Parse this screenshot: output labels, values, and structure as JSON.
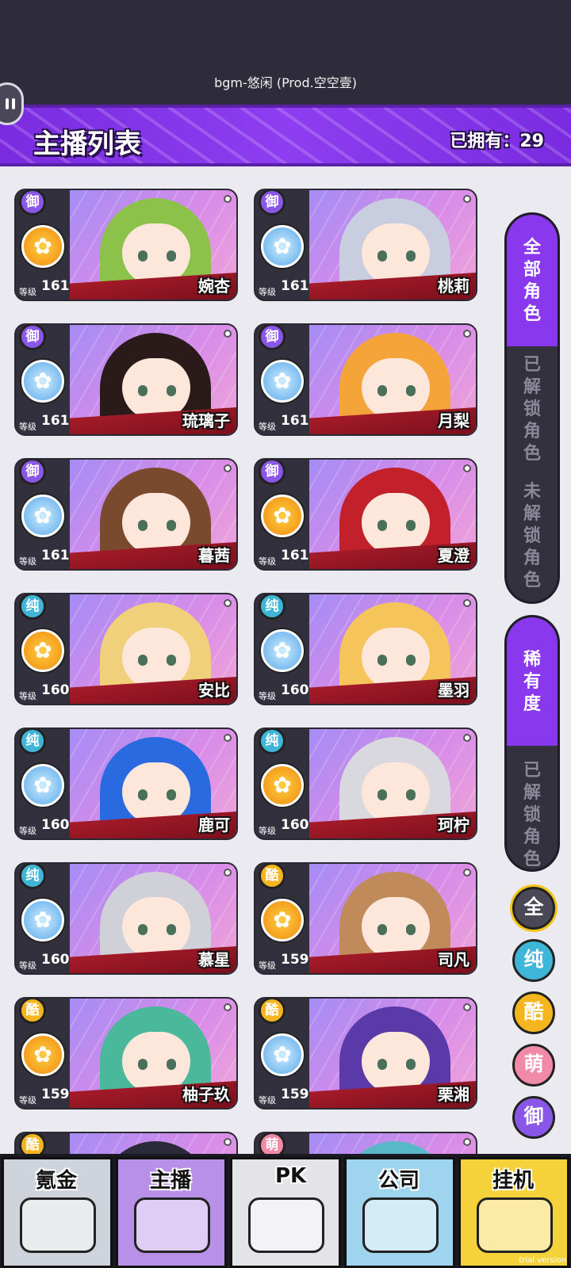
{
  "status": {
    "bgm": "bgm-悠闲 (Prod.空空壹)"
  },
  "header": {
    "title": "主播列表",
    "owned": "已拥有：29"
  },
  "cards": [
    {
      "name": "婉杏",
      "level": "161",
      "type": "御",
      "medal": "orange",
      "hair": "#8cc24a",
      "level_label": "等级"
    },
    {
      "name": "桃莉",
      "level": "161",
      "type": "御",
      "medal": "blue",
      "hair": "#c8cde0",
      "level_label": "等级"
    },
    {
      "name": "琉璃子",
      "level": "161",
      "type": "御",
      "medal": "blue",
      "hair": "#2a1a1a",
      "level_label": "等级"
    },
    {
      "name": "月梨",
      "level": "161",
      "type": "御",
      "medal": "blue",
      "hair": "#f5a43a",
      "level_label": "等级"
    },
    {
      "name": "暮茜",
      "level": "161",
      "type": "御",
      "medal": "blue",
      "hair": "#7a4a2e",
      "level_label": "等级"
    },
    {
      "name": "夏澄",
      "level": "161",
      "type": "御",
      "medal": "orange",
      "hair": "#c2202a",
      "level_label": "等级"
    },
    {
      "name": "安比",
      "level": "160",
      "type": "纯",
      "medal": "orange",
      "hair": "#f0d07a",
      "level_label": "等级"
    },
    {
      "name": "墨羽",
      "level": "160",
      "type": "纯",
      "medal": "blue",
      "hair": "#f5c45a",
      "level_label": "等级"
    },
    {
      "name": "鹿可",
      "level": "160",
      "type": "纯",
      "medal": "blue",
      "hair": "#2a6ae0",
      "level_label": "等级"
    },
    {
      "name": "珂柠",
      "level": "160",
      "type": "纯",
      "medal": "orange",
      "hair": "#d8d8de",
      "level_label": "等级"
    },
    {
      "name": "慕星",
      "level": "160",
      "type": "纯",
      "medal": "blue",
      "hair": "#d0d0d8",
      "level_label": "等级"
    },
    {
      "name": "司凡",
      "level": "159",
      "type": "酷",
      "medal": "orange",
      "hair": "#c08a5a",
      "level_label": "等级"
    },
    {
      "name": "柚子玖",
      "level": "159",
      "type": "酷",
      "medal": "orange",
      "hair": "#4ab89a",
      "level_label": "等级"
    },
    {
      "name": "栗湘",
      "level": "159",
      "type": "酷",
      "medal": "blue",
      "hair": "#5a3aa8",
      "level_label": "等级"
    },
    {
      "name": "",
      "level": "",
      "type": "酷",
      "medal": "",
      "hair": "#2a2a3a",
      "level_label": ""
    },
    {
      "name": "",
      "level": "",
      "type": "萌",
      "medal": "",
      "hair": "#58b8c8",
      "level_label": ""
    }
  ],
  "filter_group1": {
    "all": "全部角色",
    "unlocked": "已解锁角色",
    "locked": "未解锁角色"
  },
  "filter_group2": {
    "rarity": "稀有度",
    "unlocked": "已解锁角色"
  },
  "type_filters": [
    "全",
    "纯",
    "酷",
    "萌",
    "御"
  ],
  "bottom_tabs": [
    {
      "label": "氪金",
      "bg": "#cfd3dc"
    },
    {
      "label": "主播",
      "bg": "#b890e8"
    },
    {
      "label": "PK",
      "bg": "#e4e4e8"
    },
    {
      "label": "公司",
      "bg": "#9fd4ee"
    },
    {
      "label": "挂机",
      "bg": "#f5d23a"
    }
  ],
  "trial_label": "trial version",
  "colors": {
    "accent": "#8a38ee",
    "card_bg": "#3a3846"
  }
}
